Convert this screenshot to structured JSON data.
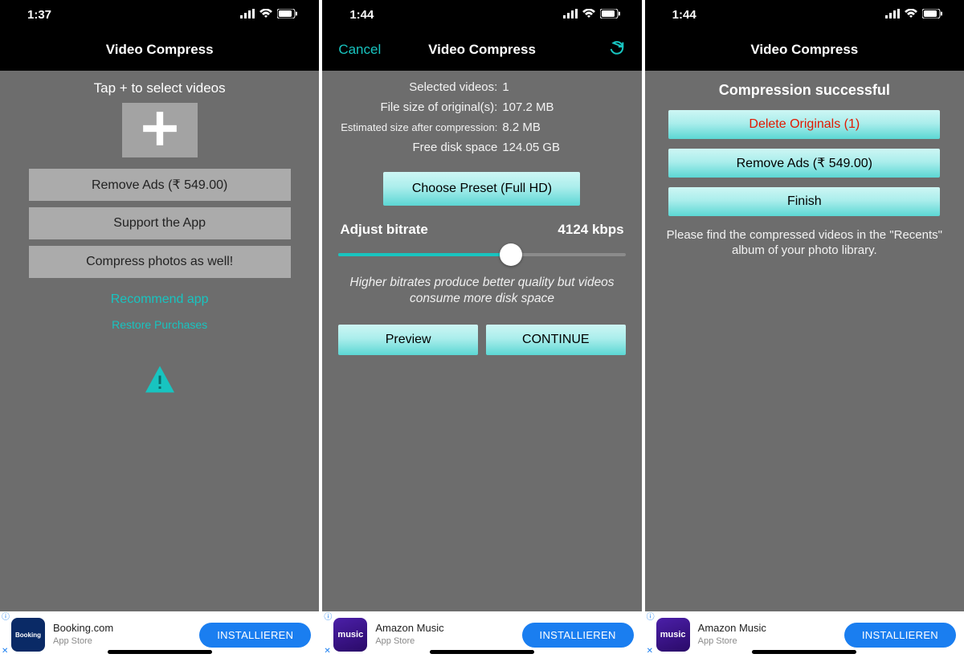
{
  "colors": {
    "accent": "#18c4c0",
    "danger": "#e11900"
  },
  "screen1": {
    "status_time": "1:37",
    "title": "Video Compress",
    "hint": "Tap + to select videos",
    "buttons": {
      "remove_ads": "Remove Ads (₹ 549.00)",
      "support": "Support the App",
      "compress_photos": "Compress photos as well!"
    },
    "links": {
      "recommend": "Recommend app",
      "restore": "Restore Purchases"
    },
    "ad": {
      "title": "Booking.com",
      "subtitle": "App Store",
      "cta": "INSTALLIEREN"
    }
  },
  "screen2": {
    "status_time": "1:44",
    "nav": {
      "cancel": "Cancel",
      "title": "Video Compress"
    },
    "info": {
      "selected_label": "Selected videos:",
      "selected_val": "1",
      "original_label": "File size of original(s):",
      "original_val": "107.2 MB",
      "est_label": "Estimated size after compression:",
      "est_val": "8.2 MB",
      "free_label": "Free disk space",
      "free_val": "124.05 GB"
    },
    "preset_btn": "Choose Preset (Full HD)",
    "bitrate_label": "Adjust bitrate",
    "bitrate_value": "4124 kbps",
    "bitrate_hint": "Higher bitrates produce better quality but videos consume more disk space",
    "preview_btn": "Preview",
    "continue_btn": "CONTINUE",
    "ad": {
      "title": "Amazon Music",
      "subtitle": "App Store",
      "cta": "INSTALLIEREN"
    }
  },
  "screen3": {
    "status_time": "1:44",
    "title": "Video Compress",
    "success": "Compression successful",
    "delete_btn": "Delete Originals (1)",
    "remove_ads_btn": "Remove Ads (₹ 549.00)",
    "finish_btn": "Finish",
    "note": "Please find the compressed videos in the \"Recents\" album of your photo library.",
    "ad": {
      "title": "Amazon Music",
      "subtitle": "App Store",
      "cta": "INSTALLIEREN"
    }
  }
}
